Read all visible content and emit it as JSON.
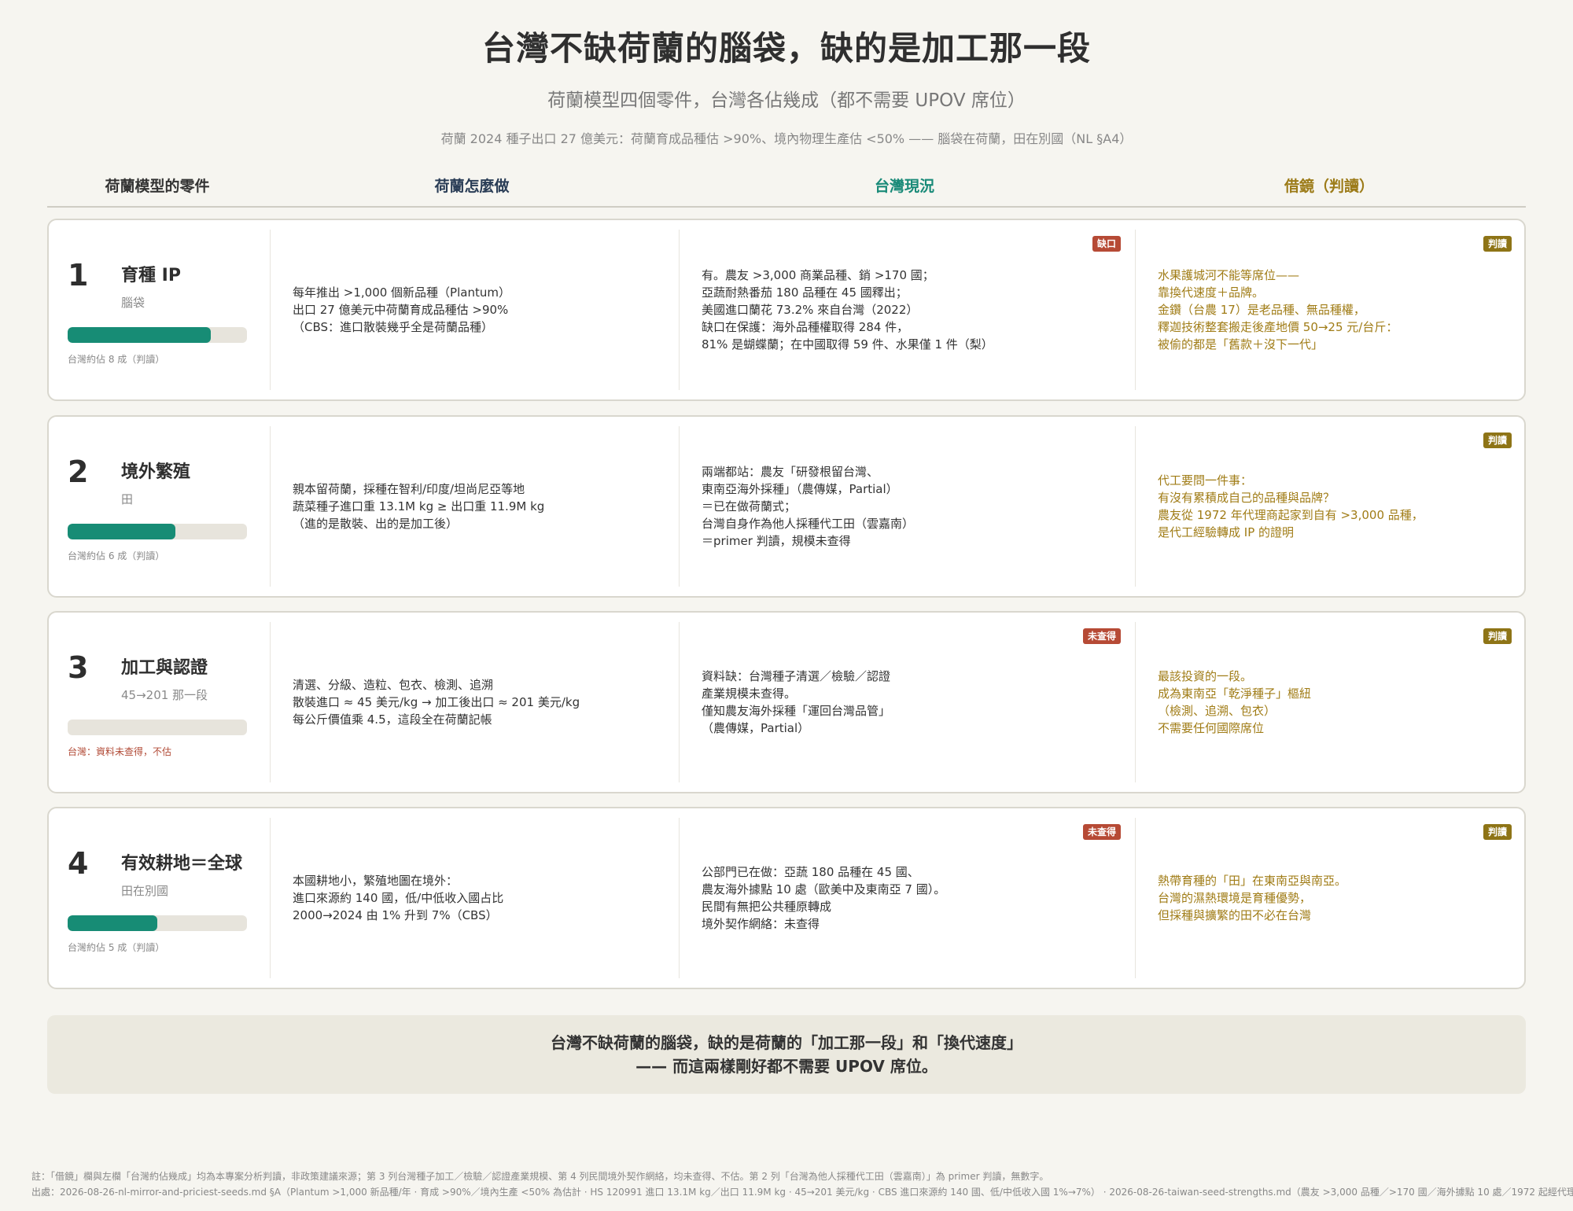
{
  "title": "台灣不缺荷蘭的腦袋，缺的是加工那一段",
  "subtitle": "荷蘭模型四個零件，台灣各佔幾成（都不需要 UPOV 席位）",
  "source_line": "荷蘭 2024 種子出口 27 億美元：荷蘭育成品種估 >90%、境內物理生產估 <50% —— 腦袋在荷蘭，田在別國（NL §A4）",
  "columns": [
    "荷蘭模型的零件",
    "荷蘭怎麼做",
    "台灣現況",
    "借鏡（判讀）"
  ],
  "colors": {
    "teal": "#178c75",
    "red": "#b64a35",
    "gold": "#8e7416"
  },
  "rows": [
    {
      "num": "1",
      "name": "育種 IP",
      "sub": "腦袋",
      "share": 0.8,
      "share_note": "台灣約佔 8 成（判讀）",
      "nl": [
        "每年推出 >1,000 個新品種（Plantum）",
        "出口 27 億美元中荷蘭育成品種估 >90%",
        "（CBS：進口散裝幾乎全是荷蘭品種）"
      ],
      "tw_badge": "缺口",
      "tw": [
        "有。農友 >3,000 商業品種、銷 >170 國；",
        "亞蔬耐熱番茄 180 品種在 45 國釋出；",
        "美國進口蘭花 73.2% 來自台灣（2022）",
        "缺口在保護：海外品種權取得 284 件，",
        "81% 是蝴蝶蘭；在中國取得 59 件、水果僅 1 件（梨）"
      ],
      "judge_badge": "判讀",
      "judge": [
        "水果護城河不能等席位——",
        "靠換代速度＋品牌。",
        "金鑽（台農 17）是老品種、無品種權，",
        "釋迦技術整套搬走後產地價 50→25 元/台斤：",
        "被偷的都是「舊款＋沒下一代」"
      ]
    },
    {
      "num": "2",
      "name": "境外繁殖",
      "sub": "田",
      "share": 0.6,
      "share_note": "台灣約佔 6 成（判讀）",
      "nl": [
        "親本留荷蘭，採種在智利/印度/坦尚尼亞等地",
        "蔬菜種子進口重 13.1M kg ≥ 出口重 11.9M kg",
        "（進的是散裝、出的是加工後）"
      ],
      "tw_badge": "",
      "tw": [
        "兩端都站：農友「研發根留台灣、",
        "東南亞海外採種」（農傳媒，Partial）",
        "＝已在做荷蘭式；",
        "台灣自身作為他人採種代工田（雲嘉南）",
        "＝primer 判讀，規模未查得"
      ],
      "judge_badge": "判讀",
      "judge": [
        "代工要問一件事：",
        "有沒有累積成自己的品種與品牌？",
        "農友從 1972 年代理商起家到自有 >3,000 品種，",
        "是代工經驗轉成 IP 的證明"
      ]
    },
    {
      "num": "3",
      "name": "加工與認證",
      "sub": "45→201 那一段",
      "share": 0,
      "share_note": "台灣：資料未查得，不估",
      "nl": [
        "清選、分級、造粒、包衣、檢測、追溯",
        "散裝進口 ≈ 45 美元/kg → 加工後出口 ≈ 201 美元/kg",
        "每公斤價值乘 4.5，這段全在荷蘭記帳"
      ],
      "tw_badge": "未查得",
      "tw": [
        "資料缺：台灣種子清選／檢驗／認證",
        "產業規模未查得。",
        "僅知農友海外採種「運回台灣品管」",
        "（農傳媒，Partial）"
      ],
      "judge_badge": "判讀",
      "judge": [
        "最該投資的一段。",
        "成為東南亞「乾淨種子」樞紐",
        "（檢測、追溯、包衣）",
        "不需要任何國際席位"
      ]
    },
    {
      "num": "4",
      "name": "有效耕地＝全球",
      "sub": "田在別國",
      "share": 0.5,
      "share_note": "台灣約佔 5 成（判讀）",
      "nl": [
        "本國耕地小，繁殖地圖在境外：",
        "進口來源約 140 國，低/中低收入國占比",
        "2000→2024 由 1% 升到 7%（CBS）"
      ],
      "tw_badge": "未查得",
      "tw": [
        "公部門已在做：亞蔬 180 品種在 45 國、",
        "農友海外據點 10 處（歐美中及東南亞 7 國）。",
        "民間有無把公共種原轉成",
        "境外契作網絡：未查得"
      ],
      "judge_badge": "判讀",
      "judge": [
        "熱帶育種的「田」在東南亞與南亞。",
        "台灣的濕熱環境是育種優勢，",
        "但採種與擴繁的田不必在台灣"
      ]
    }
  ],
  "conclusion": [
    "台灣不缺荷蘭的腦袋，缺的是荷蘭的「加工那一段」和「換代速度」",
    "—— 而這兩樣剛好都不需要 UPOV 席位。"
  ],
  "footer": [
    "註：「借鏡」欄與左欄「台灣約佔幾成」均為本專案分析判讀，非政策建議來源；第 3 列台灣種子加工／檢驗／認證產業規模、第 4 列民間境外契作網絡，均未查得、不估。第 2 列「台灣為他人採種代工田（雲嘉南）」為 primer 判讀，無數字。",
    "出處：2026-08-26-nl-mirror-and-priciest-seeds.md §A（Plantum >1,000 新品種/年 · 育成 >90%／境內生產 <50% 為估計 · HS 120991 進口 13.1M kg／出口 11.9M kg · 45→201 美元/kg · CBS 進口來源約 140 國、低/中低收入國 1%→7%） · 2026-08-26-taiwan-seed-strengths.md（農友 >3,000 品種／>170 國／海外據點 10 處／1972 起經代理商"
  ]
}
